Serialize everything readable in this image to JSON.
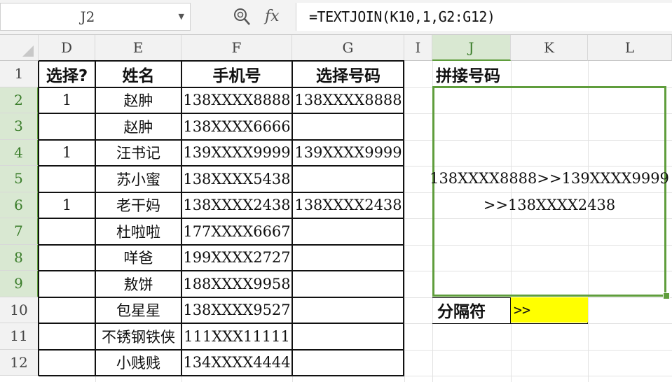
{
  "formula_bar": {
    "name_box": "J2",
    "fx_label": "fx",
    "formula": "=TEXTJOIN(K10,1,G2:G12)"
  },
  "columns": [
    "D",
    "E",
    "F",
    "G",
    "I",
    "J",
    "K",
    "L"
  ],
  "rows": [
    "1",
    "2",
    "3",
    "4",
    "5",
    "6",
    "7",
    "8",
    "9",
    "10",
    "11",
    "12"
  ],
  "table": {
    "headers": {
      "select": "选择?",
      "name": "姓名",
      "phone": "手机号",
      "chosen": "选择号码"
    },
    "records": [
      {
        "select": "1",
        "name": "赵肿",
        "phone": "138XXXX8888",
        "chosen": "138XXXX8888"
      },
      {
        "select": "",
        "name": "赵肿",
        "phone": "138XXXX6666",
        "chosen": ""
      },
      {
        "select": "1",
        "name": "汪书记",
        "phone": "139XXXX9999",
        "chosen": "139XXXX9999"
      },
      {
        "select": "",
        "name": "苏小蜜",
        "phone": "138XXXX5438",
        "chosen": ""
      },
      {
        "select": "1",
        "name": "老干妈",
        "phone": "138XXXX2438",
        "chosen": "138XXXX2438"
      },
      {
        "select": "",
        "name": "杜啦啦",
        "phone": "177XXXX6667",
        "chosen": ""
      },
      {
        "select": "",
        "name": "咩爸",
        "phone": "199XXXX2727",
        "chosen": ""
      },
      {
        "select": "",
        "name": "敖饼",
        "phone": "188XXXX9958",
        "chosen": ""
      },
      {
        "select": "",
        "name": "包星星",
        "phone": "138XXXX9527",
        "chosen": ""
      },
      {
        "select": "",
        "name": "不锈钢铁侠",
        "phone": "111XXX11111",
        "chosen": ""
      },
      {
        "select": "",
        "name": "小贱贱",
        "phone": "134XXXX4444",
        "chosen": ""
      }
    ]
  },
  "result": {
    "title": "拼接号码",
    "line1": "138XXXX8888>>139XXXX9999",
    "line2": ">>138XXXX2438",
    "separator_label": "分隔符",
    "separator_value": ">>"
  },
  "colors": {
    "selection": "#5f9d3c",
    "highlight": "#ffff00"
  }
}
